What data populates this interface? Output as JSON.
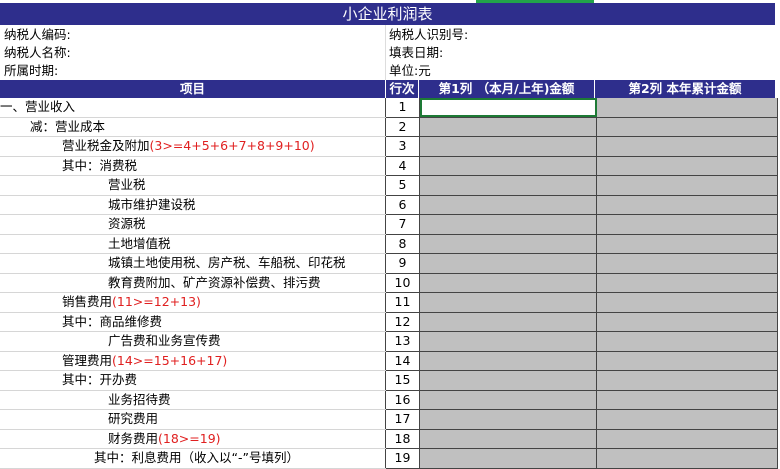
{
  "title": "小企业利润表",
  "info": {
    "taxpayer_code": "纳税人编码:",
    "taxpayer_id": "纳税人识别号:",
    "taxpayer_name": "纳税人名称:",
    "fill_date": "填表日期:",
    "period": "所属时期:",
    "unit": "单位:元"
  },
  "headers": {
    "item": "项目",
    "seq": "行次",
    "col1": "第1列 （本月/上年)金额",
    "col2": "第2列  本年累计金额"
  },
  "rows": [
    {
      "text": "一、营业收入",
      "note": "",
      "seq": "1",
      "indent": 0
    },
    {
      "text": "减：营业成本",
      "note": "",
      "seq": "2",
      "indent": 30
    },
    {
      "text": "营业税金及附加",
      "note": "(3>=4+5+6+7+8+9+10)",
      "seq": "3",
      "indent": 62
    },
    {
      "text": "其中：消费税",
      "note": "",
      "seq": "4",
      "indent": 62
    },
    {
      "text": "营业税",
      "note": "",
      "seq": "5",
      "indent": 108
    },
    {
      "text": "城市维护建设税",
      "note": "",
      "seq": "6",
      "indent": 108
    },
    {
      "text": "资源税",
      "note": "",
      "seq": "7",
      "indent": 108
    },
    {
      "text": "土地增值税",
      "note": "",
      "seq": "8",
      "indent": 108
    },
    {
      "text": "城镇土地使用税、房产税、车船税、印花税",
      "note": "",
      "seq": "9",
      "indent": 108
    },
    {
      "text": "教育费附加、矿产资源补偿费、排污费",
      "note": "",
      "seq": "10",
      "indent": 108
    },
    {
      "text": "销售费用",
      "note": "(11>=12+13)",
      "seq": "11",
      "indent": 62
    },
    {
      "text": "其中：商品维修费",
      "note": "",
      "seq": "12",
      "indent": 62
    },
    {
      "text": "广告费和业务宣传费",
      "note": "",
      "seq": "13",
      "indent": 108
    },
    {
      "text": "管理费用",
      "note": "(14>=15+16+17)",
      "seq": "14",
      "indent": 62
    },
    {
      "text": "其中：开办费",
      "note": "",
      "seq": "15",
      "indent": 62
    },
    {
      "text": "业务招待费",
      "note": "",
      "seq": "16",
      "indent": 108
    },
    {
      "text": "研究费用",
      "note": "",
      "seq": "17",
      "indent": 108
    },
    {
      "text": "财务费用",
      "note": "(18>=19)",
      "seq": "18",
      "indent": 108
    },
    {
      "text": "其中：利息费用（收入以“-”号填列）",
      "note": "",
      "seq": "19",
      "indent": 94
    }
  ]
}
